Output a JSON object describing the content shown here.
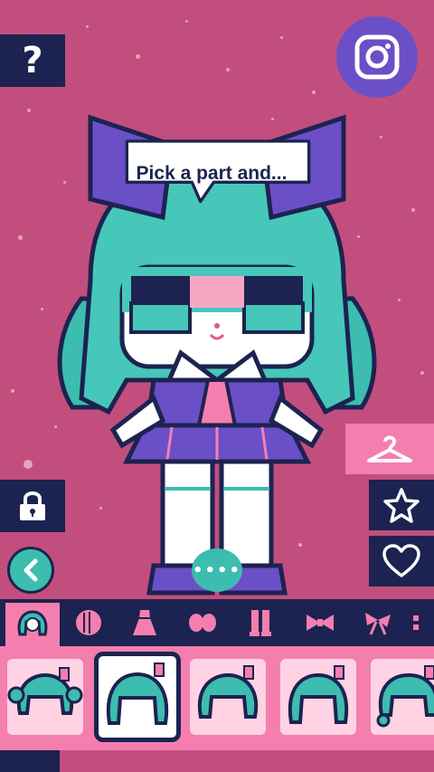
{
  "speech_bubble": {
    "text": "Pick a part and..."
  },
  "buttons": {
    "help_glyph": "?",
    "more_glyph": "••••"
  },
  "icons": {
    "help": "question-mark-icon",
    "instagram": "instagram-icon",
    "lock": "lock-icon",
    "hanger": "hanger-icon",
    "star": "star-icon",
    "heart": "heart-icon",
    "back": "chevron-left-icon",
    "more": "more-dots-icon"
  },
  "categories": [
    {
      "name": "hair",
      "active": true
    },
    {
      "name": "face",
      "active": false
    },
    {
      "name": "dress",
      "active": false
    },
    {
      "name": "gloves",
      "active": false
    },
    {
      "name": "legs",
      "active": false
    },
    {
      "name": "bow",
      "active": false
    },
    {
      "name": "ribbon",
      "active": false
    },
    {
      "name": "more",
      "active": false
    }
  ],
  "items": [
    {
      "style": "hair-pigtails",
      "selected": false
    },
    {
      "style": "hair-bob",
      "selected": true
    },
    {
      "style": "hair-bob-short",
      "selected": false
    },
    {
      "style": "hair-bob-long",
      "selected": false
    },
    {
      "style": "hair-curled",
      "selected": false
    }
  ],
  "colors": {
    "background": "#c24e7e",
    "navy": "#1c2350",
    "pink": "#f47fae",
    "teal": "#3dbcb0",
    "purple": "#6b4fc6"
  }
}
